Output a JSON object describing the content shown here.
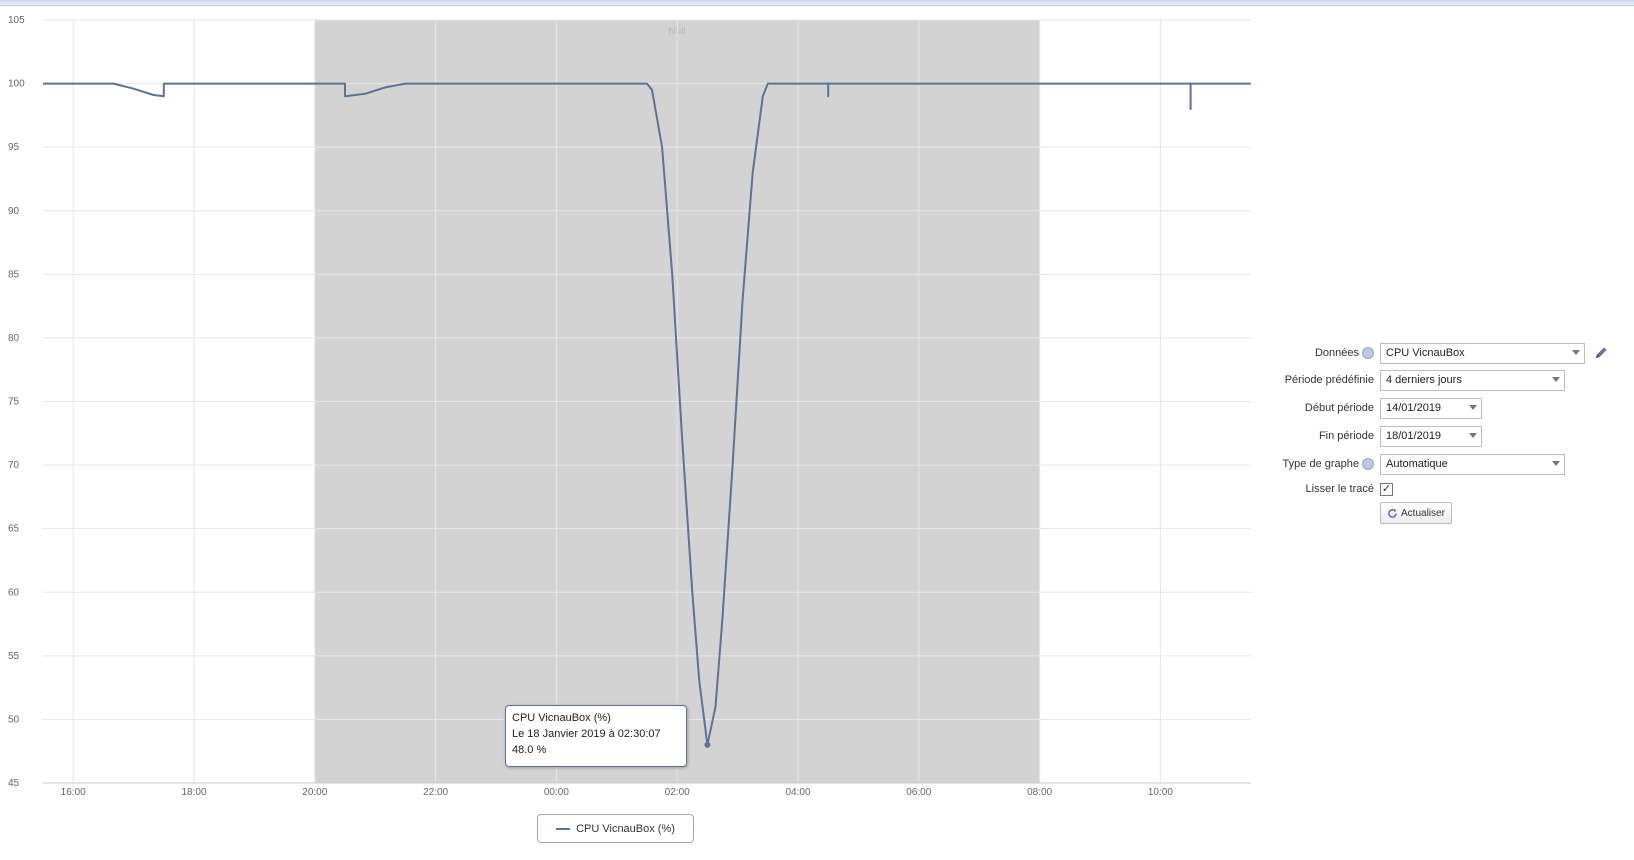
{
  "chart_data": {
    "type": "line",
    "title": "",
    "xlabel": "",
    "ylabel": "",
    "ylim": [
      45,
      105
    ],
    "xlim": [
      "15:30",
      "11:30"
    ],
    "y_ticks": [
      "105",
      "100",
      "95",
      "90",
      "85",
      "80",
      "75",
      "70",
      "65",
      "60",
      "55",
      "50",
      "45"
    ],
    "x_ticks": [
      "16:00",
      "18:00",
      "20:00",
      "22:00",
      "00:00",
      "02:00",
      "04:00",
      "06:00",
      "08:00",
      "10:00"
    ],
    "plot_bands": [
      {
        "from": "20:00",
        "to": "08:00",
        "label": "Nuit"
      }
    ],
    "grid": "vertical at each x tick and horizontal at each y tick",
    "legend_position": "bottom-center",
    "series": [
      {
        "name": "CPU VicnauBox (%)",
        "color": "#5b7495",
        "points": [
          [
            "15:30",
            100
          ],
          [
            "16:40",
            100
          ],
          [
            "17:00",
            99.6
          ],
          [
            "17:20",
            99.1
          ],
          [
            "17:30",
            99
          ],
          [
            "17:30",
            100
          ],
          [
            "20:30",
            100
          ],
          [
            "20:30",
            99
          ],
          [
            "20:50",
            99.2
          ],
          [
            "21:10",
            99.7
          ],
          [
            "21:30",
            100
          ],
          [
            "01:30",
            100
          ],
          [
            "01:35",
            99.5
          ],
          [
            "01:45",
            95
          ],
          [
            "01:55",
            85
          ],
          [
            "02:05",
            72
          ],
          [
            "02:15",
            60
          ],
          [
            "02:22",
            53
          ],
          [
            "02:30",
            48
          ],
          [
            "02:38",
            51
          ],
          [
            "02:45",
            58
          ],
          [
            "02:55",
            70
          ],
          [
            "03:05",
            83
          ],
          [
            "03:15",
            93
          ],
          [
            "03:25",
            99
          ],
          [
            "03:30",
            100
          ],
          [
            "04:30",
            100
          ],
          [
            "04:30",
            99
          ],
          [
            "04:30",
            100
          ],
          [
            "10:30",
            100
          ],
          [
            "10:30",
            98
          ],
          [
            "10:30",
            100
          ],
          [
            "11:30",
            100
          ]
        ]
      }
    ]
  },
  "tooltip": {
    "line1": "CPU VicnauBox (%)",
    "line2": "Le 18 Janvier 2019 à 02:30:07",
    "line3": "48.0 %"
  },
  "form": {
    "donnees_label": "Données",
    "donnees_value": "CPU VicnauBox",
    "periode_label": "Période prédéfinie",
    "periode_value": "4 derniers jours",
    "debut_label": "Début période",
    "debut_value": "14/01/2019",
    "fin_label": "Fin période",
    "fin_value": "18/01/2019",
    "type_label": "Type de graphe",
    "type_value": "Automatique",
    "lisser_label": "Lisser le tracé",
    "lisser_checked": true,
    "actualiser_label": "Actualiser"
  },
  "colors": {
    "band": "#d3d3d3",
    "line": "#5b7495",
    "grid": "#e6e6e6"
  },
  "icons": [
    "help-icon",
    "pencil-icon",
    "refresh-icon",
    "chevron-down-icon",
    "checkbox-icon"
  ]
}
